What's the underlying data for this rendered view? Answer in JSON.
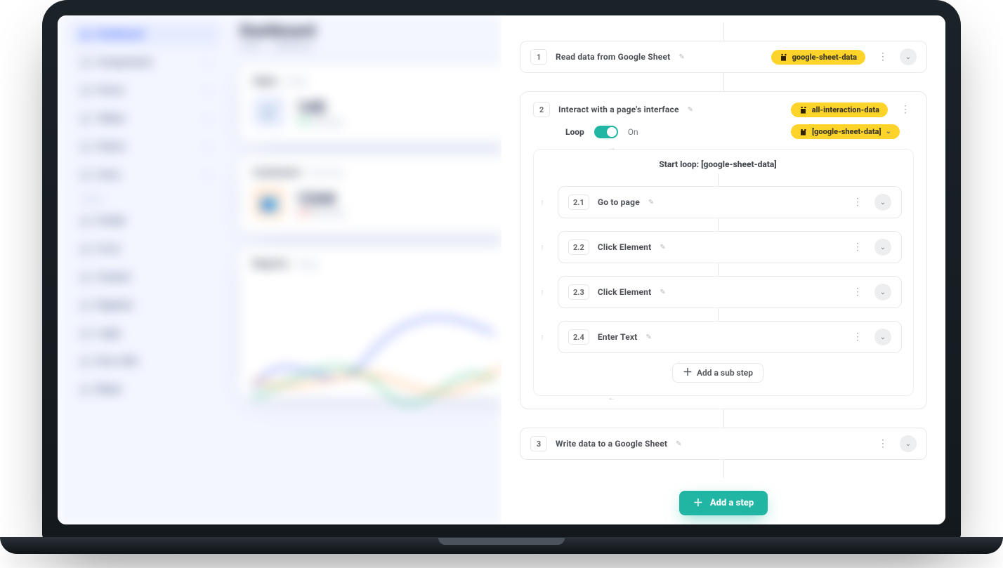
{
  "left": {
    "title": "Dashboard",
    "active_nav": "Dashboard",
    "crumbs": [
      "Home",
      "Dashboard"
    ],
    "nav": [
      "Dashboard",
      "Components",
      "Forms",
      "Tables",
      "Charts",
      "Icons"
    ],
    "nav_group_label": "PAGES",
    "nav2": [
      "Profile",
      "F.A.Q",
      "Contact",
      "Register",
      "Login",
      "Error 404",
      "Blank"
    ],
    "cards": {
      "sales": {
        "heading": "Sales",
        "sub": "| Today",
        "value": "145",
        "pct": "12%",
        "pct_label": "increase"
      },
      "customers": {
        "heading": "Customers",
        "sub": "| This Year",
        "value": "1244",
        "pct": "12%",
        "pct_label": "decrease"
      },
      "reports": {
        "heading": "Reports",
        "sub": "| Today"
      }
    }
  },
  "flow": {
    "steps": [
      {
        "n": "1",
        "title": "Read data from Google Sheet",
        "tag": "google-sheet-data"
      },
      {
        "n": "2",
        "title": "Interact with a page's interface",
        "tag": "all-interaction-data"
      },
      {
        "n": "3",
        "title": "Write data to a Google Sheet"
      }
    ],
    "loop": {
      "label": "Loop",
      "state": "On",
      "source_tag": "[google-sheet-data]",
      "title": "Start loop: [google-sheet-data]",
      "subs": [
        {
          "n": "2.1",
          "title": "Go to page"
        },
        {
          "n": "2.2",
          "title": "Click Element"
        },
        {
          "n": "2.3",
          "title": "Click Element"
        },
        {
          "n": "2.4",
          "title": "Enter Text"
        }
      ],
      "add_sub_label": "Add a sub step"
    },
    "add_step_label": "Add a step"
  }
}
